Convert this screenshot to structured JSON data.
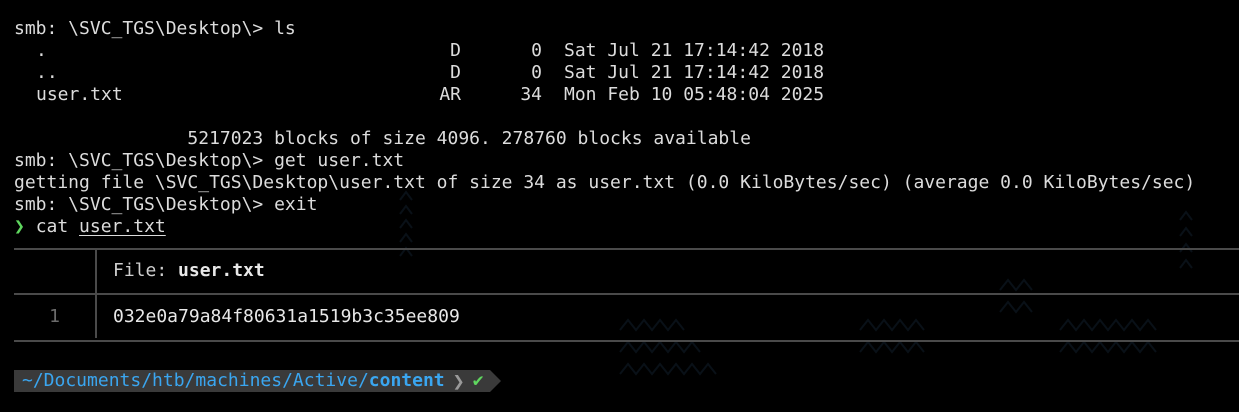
{
  "session": {
    "prompt1": "smb: \\SVC_TGS\\Desktop\\> ls",
    "listing": [
      {
        "name": ".",
        "attr": "D",
        "size": "0",
        "date": "Sat Jul 21 17:14:42 2018"
      },
      {
        "name": "..",
        "attr": "D",
        "size": "0",
        "date": "Sat Jul 21 17:14:42 2018"
      },
      {
        "name": "user.txt",
        "attr": "AR",
        "size": "34",
        "date": "Mon Feb 10 05:48:04 2025"
      }
    ],
    "blocks_line": "                5217023 blocks of size 4096. 278760 blocks available",
    "prompt2": "smb: \\SVC_TGS\\Desktop\\> get user.txt",
    "getting_line": "getting file \\SVC_TGS\\Desktop\\user.txt of size 34 as user.txt (0.0 KiloBytes/sec) (average 0.0 KiloBytes/sec)",
    "prompt3": "smb: \\SVC_TGS\\Desktop\\> exit",
    "shell_arrow": "❯",
    "shell_cmd": "cat",
    "shell_arg": "user.txt"
  },
  "bat": {
    "file_label": "File:",
    "file_name": "user.txt",
    "line_number": "1",
    "content": "032e0a79a84f80631a1519b3c35ee809"
  },
  "powerline": {
    "path": "~/Documents/htb/machines/Active/",
    "current_dir": "content",
    "separator": "❯",
    "status_icon": "✔"
  },
  "colors": {
    "background": "#000000",
    "text": "#dcdcdc",
    "prompt_arrow": "#5fd75f",
    "path": "#3aa6f0",
    "status_ok": "#5fd75f",
    "border": "#4a4a4a"
  }
}
